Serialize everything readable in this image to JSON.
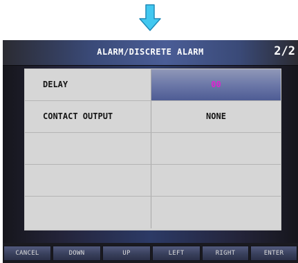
{
  "title": "ALARM/DISCRETE ALARM",
  "page_indicator": "2/2",
  "rows": [
    {
      "label": "DELAY",
      "value": "00",
      "selected": true
    },
    {
      "label": "CONTACT OUTPUT",
      "value": "NONE",
      "selected": false
    },
    {
      "label": "",
      "value": "",
      "selected": false
    },
    {
      "label": "",
      "value": "",
      "selected": false
    },
    {
      "label": "",
      "value": "",
      "selected": false
    }
  ],
  "buttons": {
    "cancel": "CANCEL",
    "down": "DOWN",
    "up": "UP",
    "left": "LEFT",
    "right": "RIGHT",
    "enter": "ENTER"
  },
  "colors": {
    "arrow": "#42c8f0",
    "selected_value_text": "#e020d0"
  },
  "icons": {
    "top_indicator": "down-arrow-icon"
  }
}
